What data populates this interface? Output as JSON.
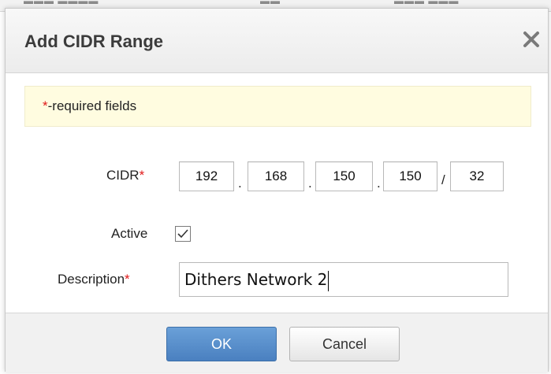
{
  "dialog": {
    "title": "Add CIDR Range",
    "notice": {
      "asterisk": "*",
      "text": "-required fields"
    },
    "cidr": {
      "label": "CIDR",
      "required_mark": "*",
      "octets": [
        "192",
        "168",
        "150",
        "150"
      ],
      "dot": ".",
      "slash": "/",
      "prefix": "32"
    },
    "active": {
      "label": "Active",
      "checked": true
    },
    "description": {
      "label": "Description",
      "required_mark": "*",
      "value": "Dithers Network 2"
    },
    "buttons": {
      "ok": "OK",
      "cancel": "Cancel"
    }
  },
  "colors": {
    "required": "#e11a1a",
    "primary_button": "#5a90cc",
    "notice_bg": "#fffce0"
  },
  "icons": {
    "close": "close-icon",
    "check": "checkmark-icon"
  }
}
